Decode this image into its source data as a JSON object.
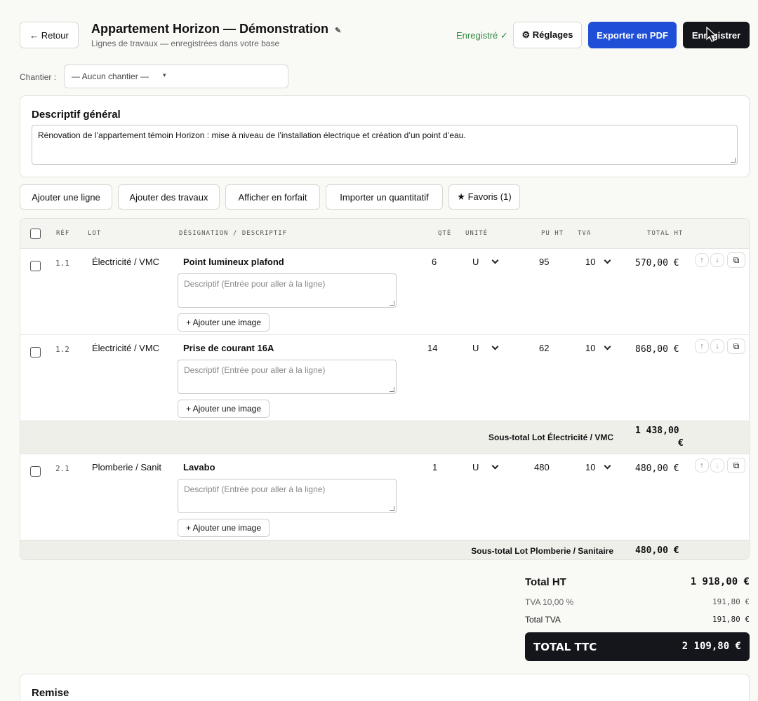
{
  "header": {
    "back_label": "← Retour",
    "title": "Appartement Horizon — Démonstration",
    "edit_icon": "pencil-icon",
    "subtitle": "Lignes de travaux — enregistrées dans votre base",
    "status": "Enregistré ✓",
    "settings_label": "⚙ Réglages",
    "export_label": "Exporter en PDF",
    "save_label": "Enregistrer"
  },
  "chantier": {
    "label": "Chantier :",
    "selected": "— Aucun chantier —",
    "caret": "▾"
  },
  "descriptif": {
    "title": "Descriptif général",
    "text": "Rénovation de l’appartement témoin Horizon : mise à niveau de l’installation électrique et création d’un point d’eau."
  },
  "toolbar": {
    "add_line": "Ajouter une ligne",
    "add_works": "Ajouter des travaux",
    "forfait": "Afficher en forfait",
    "import": "Importer un quantitatif",
    "favorites": "★ Favoris (1)"
  },
  "table": {
    "headers": {
      "ref": "RÉF",
      "lot": "LOT",
      "designation": "DÉSIGNATION / DESCRIPTIF",
      "qty": "QTÉ",
      "unit": "UNITÉ",
      "pu": "PU HT",
      "tva": "TVA",
      "total": "TOTAL HT"
    },
    "desc_placeholder": "Descriptif (Entrée pour aller à la ligne)",
    "add_image": "+ Ajouter une image",
    "rows": [
      {
        "ref": "1.1",
        "lot": "Électricité / VMC",
        "designation": "Point lumineux plafond",
        "qty": "6",
        "unit": "U",
        "pu": "95",
        "tva": "10",
        "total": "570,00 €"
      },
      {
        "ref": "1.2",
        "lot": "Électricité / VMC",
        "designation": "Prise de courant 16A",
        "qty": "14",
        "unit": "U",
        "pu": "62",
        "tva": "10",
        "total": "868,00 €"
      },
      {
        "ref": "2.1",
        "lot": "Plomberie / Sanit",
        "designation": "Lavabo",
        "qty": "1",
        "unit": "U",
        "pu": "480",
        "tva": "10",
        "total": "480,00 €"
      }
    ],
    "subtotals": [
      {
        "label": "Sous-total Lot Électricité / VMC",
        "value_line1": "1 438,00",
        "value_line2": "€"
      },
      {
        "label": "Sous-total Lot Plomberie / Sanitaire",
        "value": "480,00 €"
      }
    ],
    "icons": {
      "up": "↑",
      "down": "↓",
      "duplicate": "⧉"
    }
  },
  "totals": {
    "ht_label": "Total HT",
    "ht_value": "1 918,00 €",
    "tva_rate_label": "TVA 10,00 %",
    "tva_rate_value": "191,80 €",
    "tva_total_label": "Total TVA",
    "tva_total_value": "191,80 €",
    "ttc_label": "TOTAL TTC",
    "ttc_value": "2 109,80 €"
  },
  "remise": {
    "title": "Remise"
  },
  "colors": {
    "accent": "#1f4fd6",
    "dark": "#14161b",
    "status": "#2e8b3e"
  }
}
